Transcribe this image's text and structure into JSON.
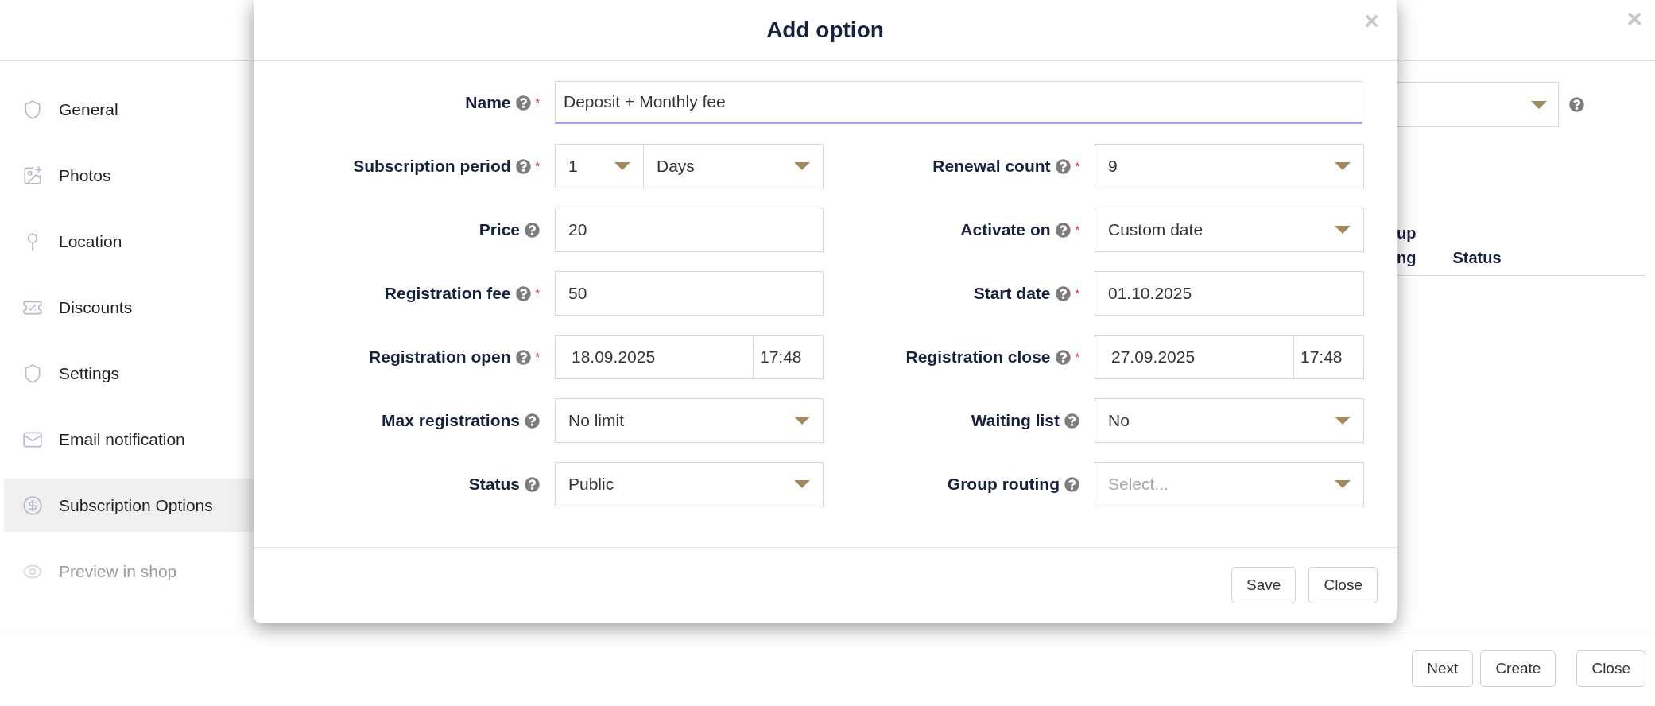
{
  "page": {
    "close": "×",
    "sidebar": {
      "items": [
        {
          "label": "General",
          "selected": false,
          "disabled": false
        },
        {
          "label": "Photos",
          "selected": false,
          "disabled": false
        },
        {
          "label": "Location",
          "selected": false,
          "disabled": false
        },
        {
          "label": "Discounts",
          "selected": false,
          "disabled": false
        },
        {
          "label": "Settings",
          "selected": false,
          "disabled": false
        },
        {
          "label": "Email notification",
          "selected": false,
          "disabled": false
        },
        {
          "label": "Subscription Options",
          "selected": true,
          "disabled": false
        },
        {
          "label": "Preview in shop",
          "selected": false,
          "disabled": true
        }
      ]
    },
    "table": {
      "columns": [
        "up\nng",
        "Status"
      ]
    },
    "footer_buttons": [
      "Next",
      "Create",
      "Close"
    ]
  },
  "modal": {
    "title": "Add option",
    "close": "×",
    "name_field": {
      "label": "Name",
      "required_mark": "*",
      "value": "Deposit + Monthly fee",
      "focused": true
    },
    "left_fields": [
      {
        "kind": "split_select",
        "label": "Subscription period",
        "required_mark": "*",
        "value": "1",
        "unit": "Days"
      },
      {
        "kind": "text",
        "label": "Price",
        "value": "20"
      },
      {
        "kind": "text",
        "label": "Registration fee",
        "required_mark": "*",
        "value": "50"
      },
      {
        "kind": "datetime",
        "label": "Registration open",
        "required_mark": "*",
        "value": "18.09.2025",
        "time": "17:48"
      },
      {
        "kind": "select",
        "label": "Max registrations",
        "value": "No limit"
      },
      {
        "kind": "select",
        "label": "Status",
        "value": "Public"
      }
    ],
    "right_fields": [
      {
        "kind": "select",
        "label": "Renewal count",
        "required_mark": "*",
        "value": "9"
      },
      {
        "kind": "select",
        "label": "Activate on",
        "required_mark": "*",
        "value": "Custom date"
      },
      {
        "kind": "text",
        "label": "Start date",
        "required_mark": "*",
        "value": "01.10.2025"
      },
      {
        "kind": "datetime",
        "label": "Registration close",
        "required_mark": "*",
        "value": "27.09.2025",
        "time": "17:48"
      },
      {
        "kind": "select",
        "label": "Waiting list",
        "value": "No"
      },
      {
        "kind": "select",
        "label": "Group routing",
        "placeholder": "Select..."
      }
    ],
    "buttons": [
      "Save",
      "Close"
    ]
  }
}
